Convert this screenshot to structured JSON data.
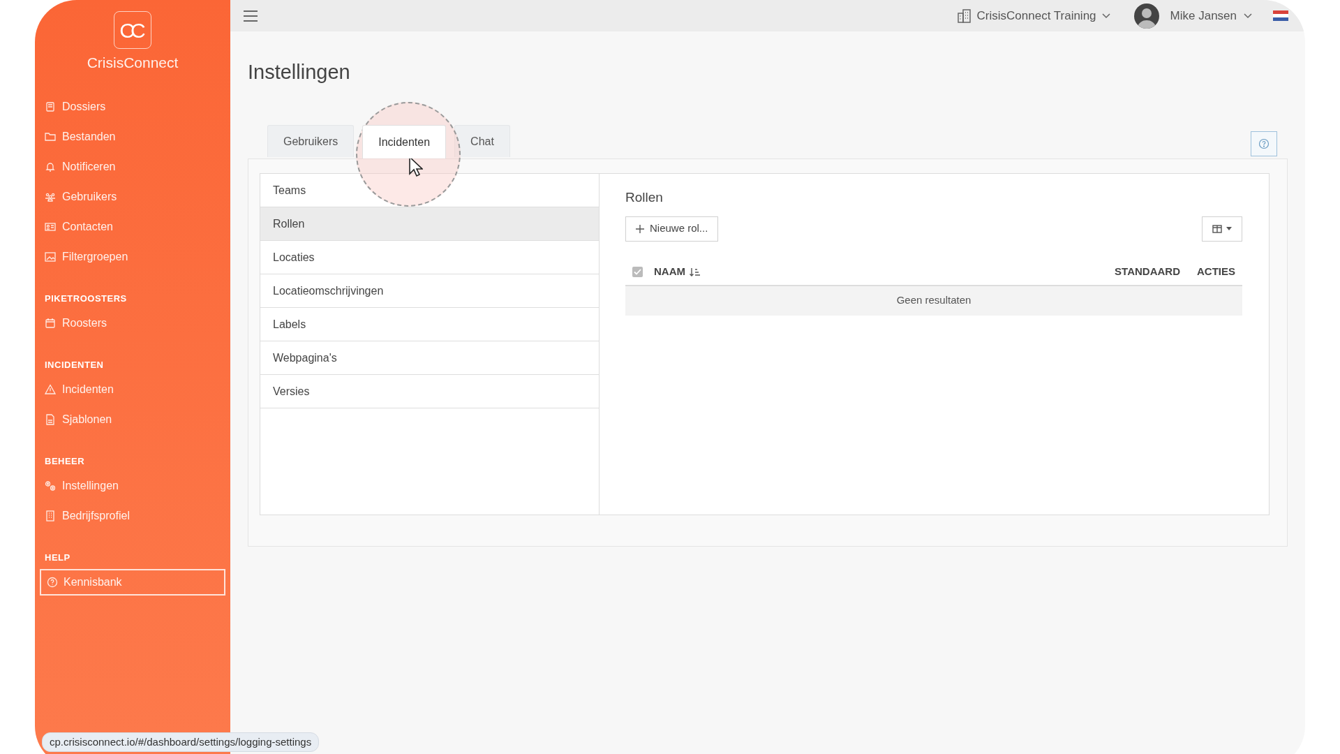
{
  "brand": {
    "logo": "CC",
    "name": "CrisisConnect"
  },
  "sidebar": {
    "sections": [
      {
        "items": [
          {
            "label": "Dossiers",
            "focused": false
          },
          {
            "label": "Bestanden",
            "focused": false
          },
          {
            "label": "Notificeren",
            "focused": false
          },
          {
            "label": "Gebruikers",
            "focused": false
          },
          {
            "label": "Contacten",
            "focused": false
          },
          {
            "label": "Filtergroepen",
            "focused": false
          }
        ]
      },
      {
        "heading": "PIKETROOSTERS",
        "items": [
          {
            "label": "Roosters",
            "focused": false
          }
        ]
      },
      {
        "heading": "INCIDENTEN",
        "items": [
          {
            "label": "Incidenten",
            "focused": false
          },
          {
            "label": "Sjablonen",
            "focused": false
          }
        ]
      },
      {
        "heading": "BEHEER",
        "items": [
          {
            "label": "Instellingen",
            "focused": false
          },
          {
            "label": "Bedrijfsprofiel",
            "focused": false
          }
        ]
      },
      {
        "heading": "HELP",
        "items": [
          {
            "label": "Kennisbank",
            "focused": true
          }
        ]
      }
    ]
  },
  "topbar": {
    "organization": "CrisisConnect Training",
    "user": "Mike Jansen"
  },
  "page": {
    "title": "Instellingen",
    "tabs": [
      {
        "label": "Gebruikers",
        "selected": false
      },
      {
        "label": "Incidenten",
        "selected": true
      },
      {
        "label": "Chat",
        "selected": false
      }
    ],
    "settings_list": [
      {
        "label": "Teams",
        "selected": false
      },
      {
        "label": "Rollen",
        "selected": true
      },
      {
        "label": "Locaties",
        "selected": false
      },
      {
        "label": "Locatieomschrijvingen",
        "selected": false
      },
      {
        "label": "Labels",
        "selected": false
      },
      {
        "label": "Webpagina's",
        "selected": false
      },
      {
        "label": "Versies",
        "selected": false
      }
    ],
    "panel": {
      "title": "Rollen",
      "new_button": "Nieuwe rol...",
      "select_all_checked": true,
      "columns": [
        "NAAM",
        "STANDAARD",
        "ACTIES"
      ],
      "empty_message": "Geen resultaten"
    }
  },
  "status_url": "cp.crisisconnect.io/#/dashboard/settings/logging-settings"
}
